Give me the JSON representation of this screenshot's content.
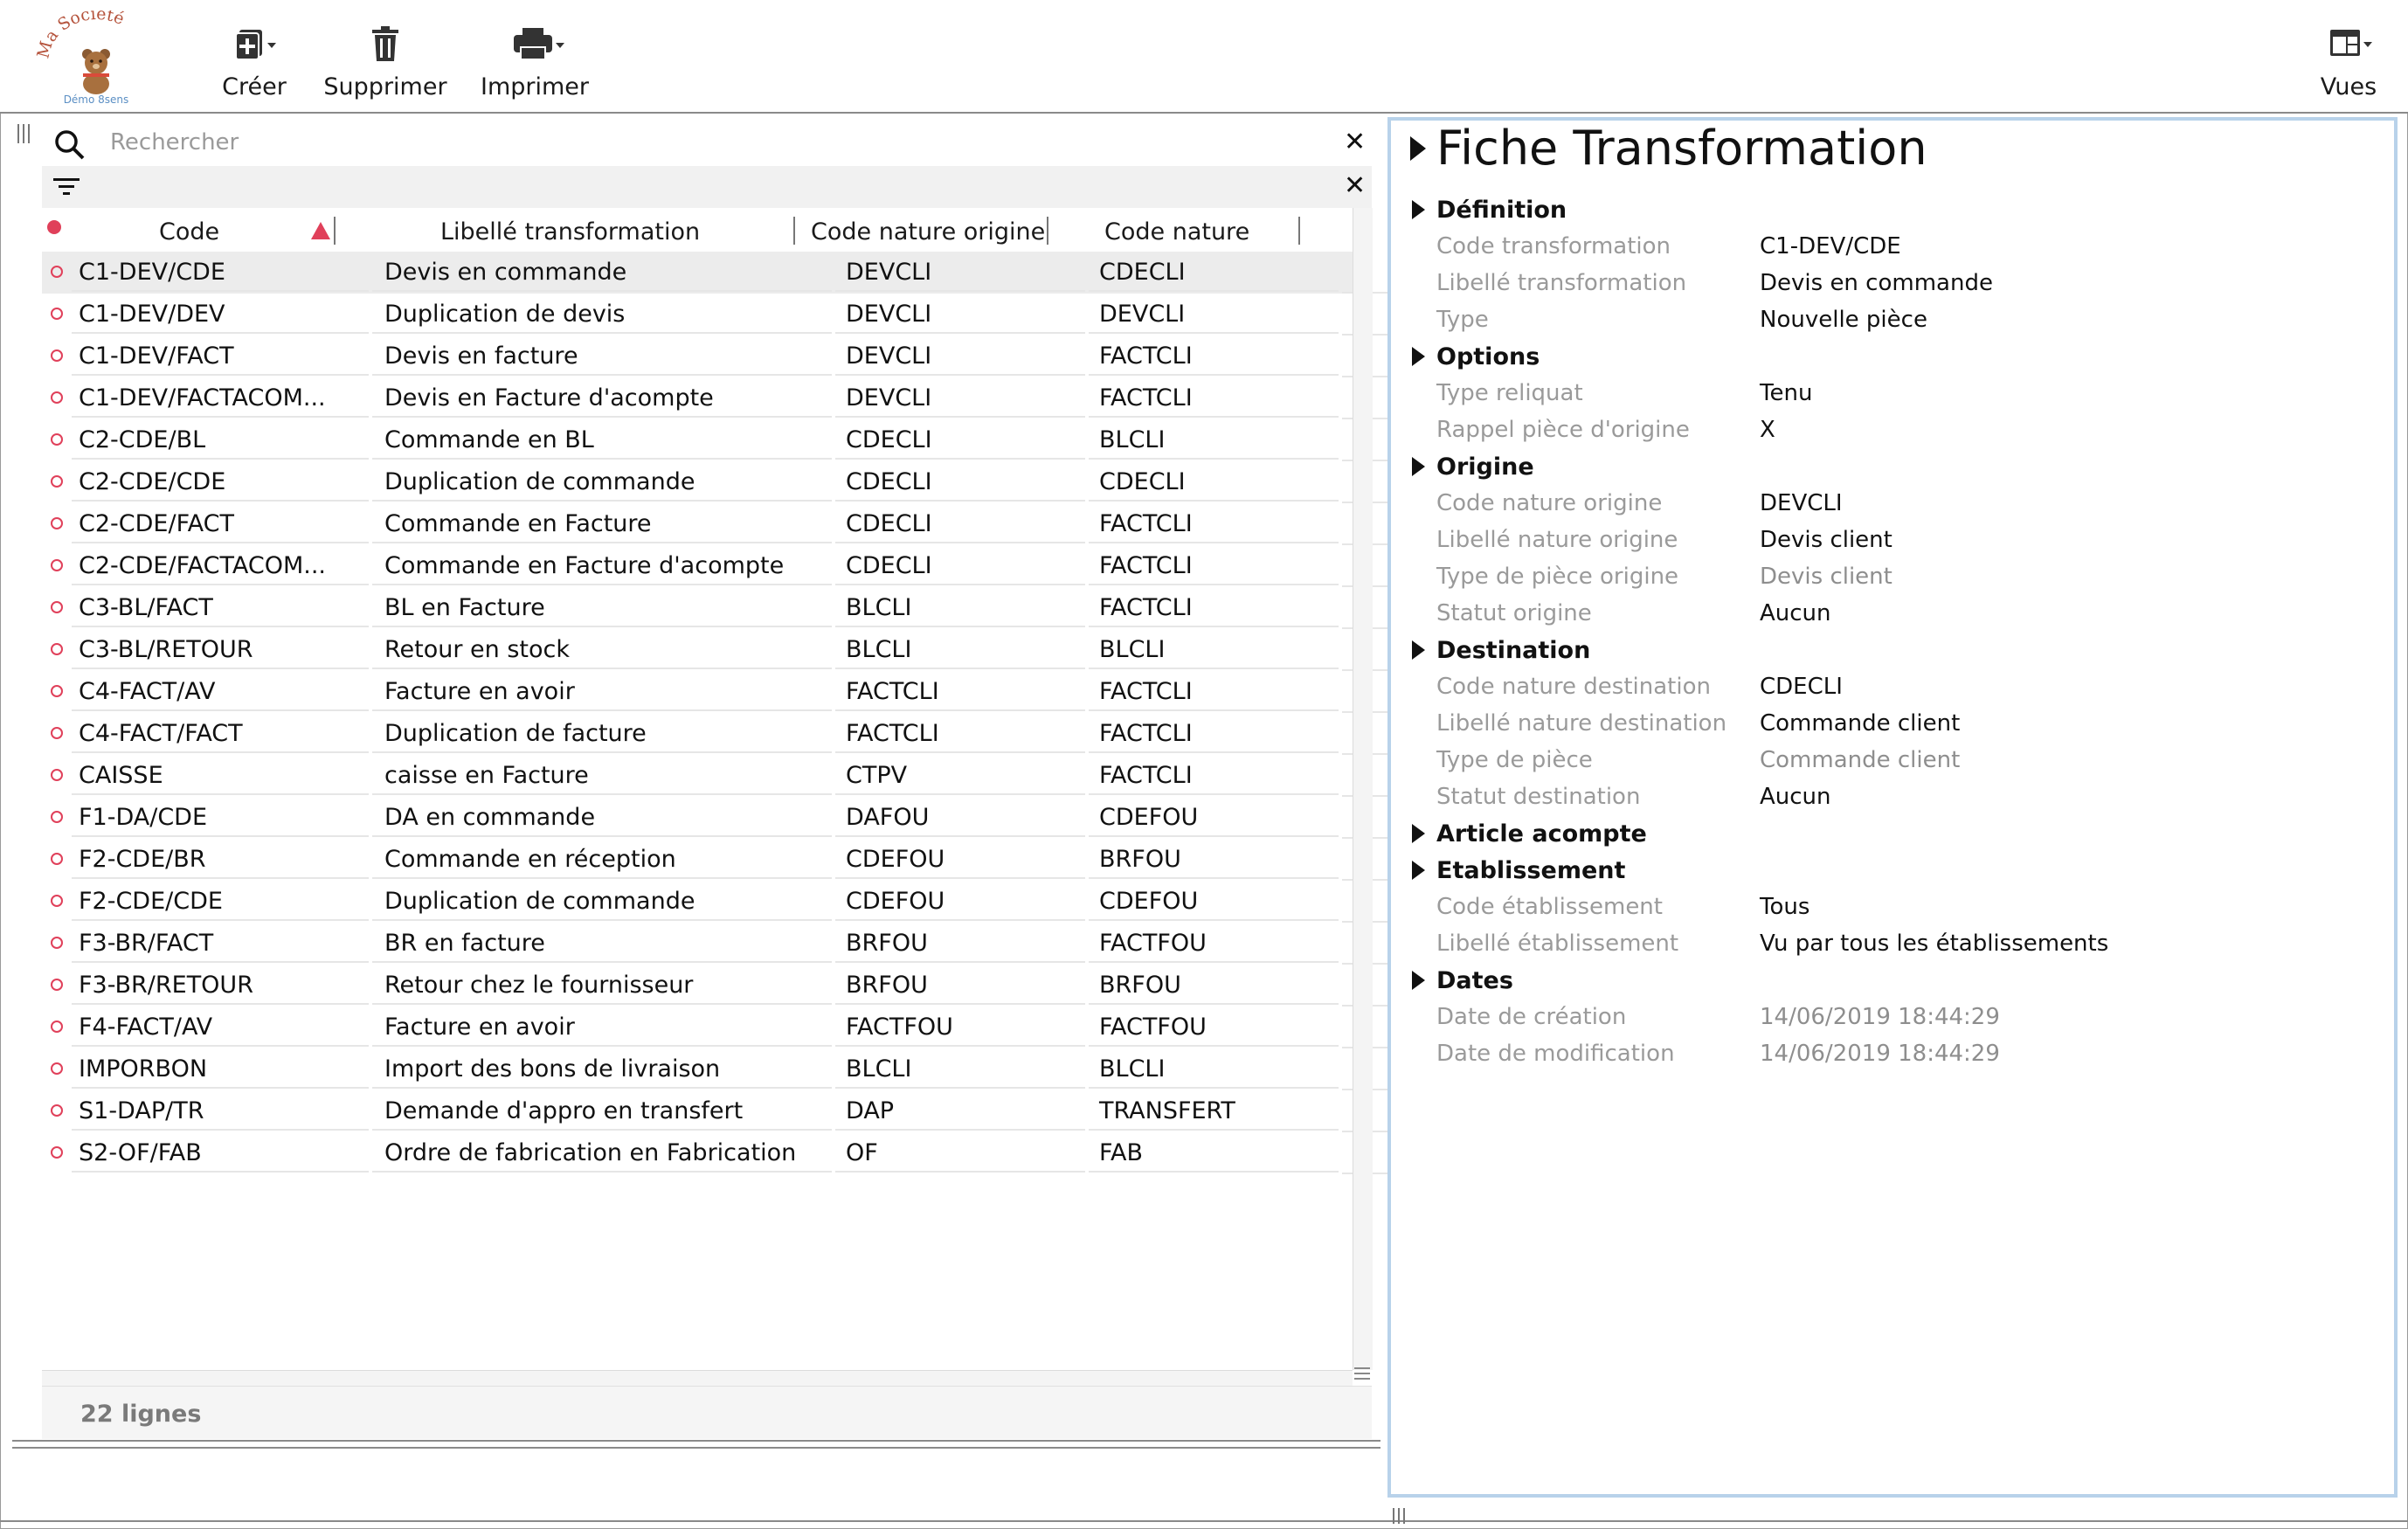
{
  "logo": {
    "line1": "Ma Société",
    "line2": "Démo 8sens"
  },
  "toolbar": {
    "create_label": "Créer",
    "delete_label": "Supprimer",
    "print_label": "Imprimer",
    "views_label": "Vues"
  },
  "search": {
    "placeholder": "Rechercher"
  },
  "table": {
    "columns": [
      "Code",
      "Libellé transformation",
      "Code nature origine",
      "Code nature"
    ],
    "sort_column": "Code",
    "sort_direction": "ascending",
    "accent_color": "#e0405a",
    "rows": [
      {
        "code": "C1-DEV/CDE",
        "libelle": "Devis en commande",
        "origine": "DEVCLI",
        "nature": "CDECLI",
        "selected": true
      },
      {
        "code": "C1-DEV/DEV",
        "libelle": "Duplication de devis",
        "origine": "DEVCLI",
        "nature": "DEVCLI"
      },
      {
        "code": "C1-DEV/FACT",
        "libelle": "Devis en facture",
        "origine": "DEVCLI",
        "nature": "FACTCLI"
      },
      {
        "code": "C1-DEV/FACTACOM...",
        "libelle": "Devis en Facture d'acompte",
        "origine": "DEVCLI",
        "nature": "FACTCLI"
      },
      {
        "code": "C2-CDE/BL",
        "libelle": "Commande en BL",
        "origine": "CDECLI",
        "nature": "BLCLI"
      },
      {
        "code": "C2-CDE/CDE",
        "libelle": "Duplication de commande",
        "origine": "CDECLI",
        "nature": "CDECLI"
      },
      {
        "code": "C2-CDE/FACT",
        "libelle": "Commande en Facture",
        "origine": "CDECLI",
        "nature": "FACTCLI"
      },
      {
        "code": "C2-CDE/FACTACOM...",
        "libelle": "Commande en Facture d'acompte",
        "origine": "CDECLI",
        "nature": "FACTCLI"
      },
      {
        "code": "C3-BL/FACT",
        "libelle": "BL en Facture",
        "origine": "BLCLI",
        "nature": "FACTCLI"
      },
      {
        "code": "C3-BL/RETOUR",
        "libelle": "Retour en stock",
        "origine": "BLCLI",
        "nature": "BLCLI"
      },
      {
        "code": "C4-FACT/AV",
        "libelle": "Facture en avoir",
        "origine": "FACTCLI",
        "nature": "FACTCLI"
      },
      {
        "code": "C4-FACT/FACT",
        "libelle": "Duplication de facture",
        "origine": "FACTCLI",
        "nature": "FACTCLI"
      },
      {
        "code": "CAISSE",
        "libelle": "caisse en Facture",
        "origine": "CTPV",
        "nature": "FACTCLI"
      },
      {
        "code": "F1-DA/CDE",
        "libelle": "DA en commande",
        "origine": "DAFOU",
        "nature": "CDEFOU"
      },
      {
        "code": "F2-CDE/BR",
        "libelle": "Commande en réception",
        "origine": "CDEFOU",
        "nature": "BRFOU"
      },
      {
        "code": "F2-CDE/CDE",
        "libelle": "Duplication de commande",
        "origine": "CDEFOU",
        "nature": "CDEFOU"
      },
      {
        "code": "F3-BR/FACT",
        "libelle": "BR en facture",
        "origine": "BRFOU",
        "nature": "FACTFOU"
      },
      {
        "code": "F3-BR/RETOUR",
        "libelle": "Retour chez le fournisseur",
        "origine": "BRFOU",
        "nature": "BRFOU"
      },
      {
        "code": "F4-FACT/AV",
        "libelle": "Facture en avoir",
        "origine": "FACTFOU",
        "nature": "FACTFOU"
      },
      {
        "code": "IMPORBON",
        "libelle": "Import des bons de livraison",
        "origine": "BLCLI",
        "nature": "BLCLI"
      },
      {
        "code": "S1-DAP/TR",
        "libelle": "Demande d'appro en transfert",
        "origine": "DAP",
        "nature": "TRANSFERT"
      },
      {
        "code": "S2-OF/FAB",
        "libelle": "Ordre de fabrication en Fabrication",
        "origine": "OF",
        "nature": "FAB"
      }
    ],
    "footer": "22 lignes"
  },
  "detail": {
    "title": "Fiche Transformation",
    "border_color": "#b8d2ea",
    "sections": {
      "definition": {
        "title": "Définition",
        "fields": [
          {
            "label": "Code transformation",
            "value": "C1-DEV/CDE"
          },
          {
            "label": "Libellé transformation",
            "value": "Devis en commande"
          },
          {
            "label": "Type",
            "value": "Nouvelle pièce"
          }
        ]
      },
      "options": {
        "title": "Options",
        "fields": [
          {
            "label": "Type reliquat",
            "value": "Tenu"
          },
          {
            "label": "Rappel pièce d'origine",
            "value": "X"
          }
        ]
      },
      "origine": {
        "title": "Origine",
        "fields": [
          {
            "label": "Code nature origine",
            "value": "DEVCLI"
          },
          {
            "label": "Libellé nature origine",
            "value": "Devis client"
          },
          {
            "label": "Type de pièce origine",
            "value": "Devis client"
          },
          {
            "label": "Statut origine",
            "value": "Aucun"
          }
        ]
      },
      "destination": {
        "title": "Destination",
        "fields": [
          {
            "label": "Code nature destination",
            "value": "CDECLI"
          },
          {
            "label": "Libellé nature destination",
            "value": "Commande client"
          },
          {
            "label": "Type de pièce",
            "value": "Commande client"
          },
          {
            "label": "Statut destination",
            "value": "Aucun"
          }
        ]
      },
      "article_acompte": {
        "title": "Article acompte"
      },
      "etablissement": {
        "title": "Etablissement",
        "fields": [
          {
            "label": "Code établissement",
            "value": "Tous"
          },
          {
            "label": "Libellé établissement",
            "value": "Vu par tous les établissements"
          }
        ]
      },
      "dates": {
        "title": "Dates",
        "fields": [
          {
            "label": "Date de création",
            "value": "14/06/2019 18:44:29"
          },
          {
            "label": "Date de modification",
            "value": "14/06/2019 18:44:29"
          }
        ]
      }
    }
  }
}
